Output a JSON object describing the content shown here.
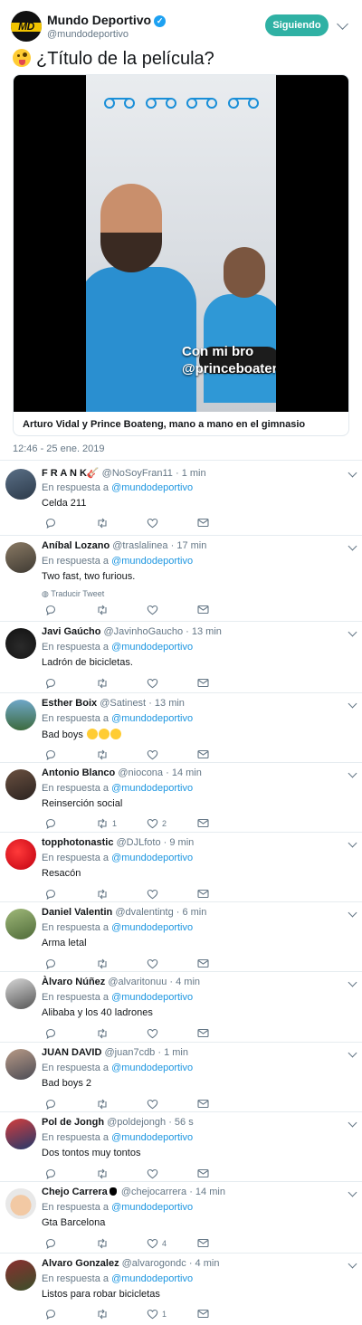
{
  "account": {
    "name": "Mundo Deportivo",
    "handle": "@mundodeportivo",
    "logo_text": "MD",
    "follow_label": "Siguiendo",
    "verified": true
  },
  "tweet": {
    "text": "¿Título de la película?",
    "emoji": "crazy-face-emoji",
    "video_caption_line1": "Con mi bro",
    "video_caption_line2": "@princeboateng",
    "card_title": "Arturo Vidal y Prince Boateng, mano a mano en el gimnasio",
    "timestamp": "12:46 - 25 ene. 2019"
  },
  "reply_prefix": "En respuesta a",
  "reply_to": "@mundodeportivo",
  "translate_label": "Traducir Tweet",
  "replies": [
    {
      "name": "F R A N K",
      "handle": "@NoSoyFran11",
      "time": "· 1 min",
      "text": "Celda 211",
      "retweets": "",
      "likes": "",
      "name_icon": "guitar-emoji"
    },
    {
      "name": "Aníbal Lozano",
      "handle": "@traslalinea",
      "time": "· 17 min",
      "text": "Two fast, two furious.",
      "retweets": "",
      "likes": "",
      "translate": true
    },
    {
      "name": "Javi Gaúcho",
      "handle": "@JavinhoGaucho",
      "time": "· 13 min",
      "text": "Ladrón de bicicletas.",
      "retweets": "",
      "likes": ""
    },
    {
      "name": "Esther Boix",
      "handle": "@Satinest",
      "time": "· 13 min",
      "text": "Bad boys",
      "retweets": "",
      "likes": "",
      "text_emojis": 3
    },
    {
      "name": "Antonio Blanco",
      "handle": "@niocona",
      "time": "· 14 min",
      "text": "Reinserción social",
      "retweets": "1",
      "likes": "2"
    },
    {
      "name": "topphotonastic",
      "handle": "@DJLfoto",
      "time": "· 9 min",
      "text": "Resacón",
      "retweets": "",
      "likes": ""
    },
    {
      "name": "Daniel Valentin",
      "handle": "@dvalentintg",
      "time": "· 6 min",
      "text": "Arma letal",
      "retweets": "",
      "likes": ""
    },
    {
      "name": "Àlvaro Núñez",
      "handle": "@alvaritonuu",
      "time": "· 4 min",
      "text": "Alibaba y los 40 ladrones",
      "retweets": "",
      "likes": ""
    },
    {
      "name": "JUAN DAVID",
      "handle": "@juan7cdb",
      "time": "· 1 min",
      "text": "Bad boys 2",
      "retweets": "",
      "likes": ""
    },
    {
      "name": "Pol de Jongh",
      "handle": "@poldejongh",
      "time": "· 56 s",
      "text": "Dos tontos muy tontos",
      "retweets": "",
      "likes": ""
    },
    {
      "name": "Chejo Carrera",
      "handle": "@chejocarrera",
      "time": "· 14 min",
      "text": "Gta Barcelona",
      "retweets": "",
      "likes": "4",
      "name_icon": "apple-icon"
    },
    {
      "name": "Alvaro Gonzalez",
      "handle": "@alvarogondc",
      "time": "· 4 min",
      "text": "Listos para robar bicicletas",
      "retweets": "",
      "likes": "1"
    }
  ],
  "colors": {
    "accent": "#1b95e0",
    "follow_button": "#2fb1a4",
    "muted": "#657786"
  }
}
